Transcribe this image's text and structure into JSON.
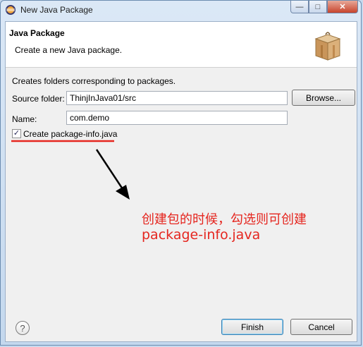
{
  "window": {
    "title": "New Java Package",
    "minimize_icon": "minimize-icon",
    "maximize_icon": "maximize-icon",
    "close_icon": "close-icon"
  },
  "banner": {
    "title": "Java Package",
    "description": "Create a new Java package.",
    "image_icon": "package-box-icon"
  },
  "form": {
    "info": "Creates folders corresponding to packages.",
    "source_folder_label": "Source folder:",
    "source_folder_value": "ThinjInJava01/src",
    "browse_label": "Browse...",
    "name_label": "Name:",
    "name_value": "com.demo",
    "checkbox_label": "Create package-info.java",
    "checkbox_checked": true
  },
  "annotation": {
    "line1": "创建包的时候，勾选则可创建",
    "line2": "package-info.java",
    "color": "#e5261f"
  },
  "footer": {
    "help_symbol": "?",
    "finish_label": "Finish",
    "cancel_label": "Cancel"
  }
}
